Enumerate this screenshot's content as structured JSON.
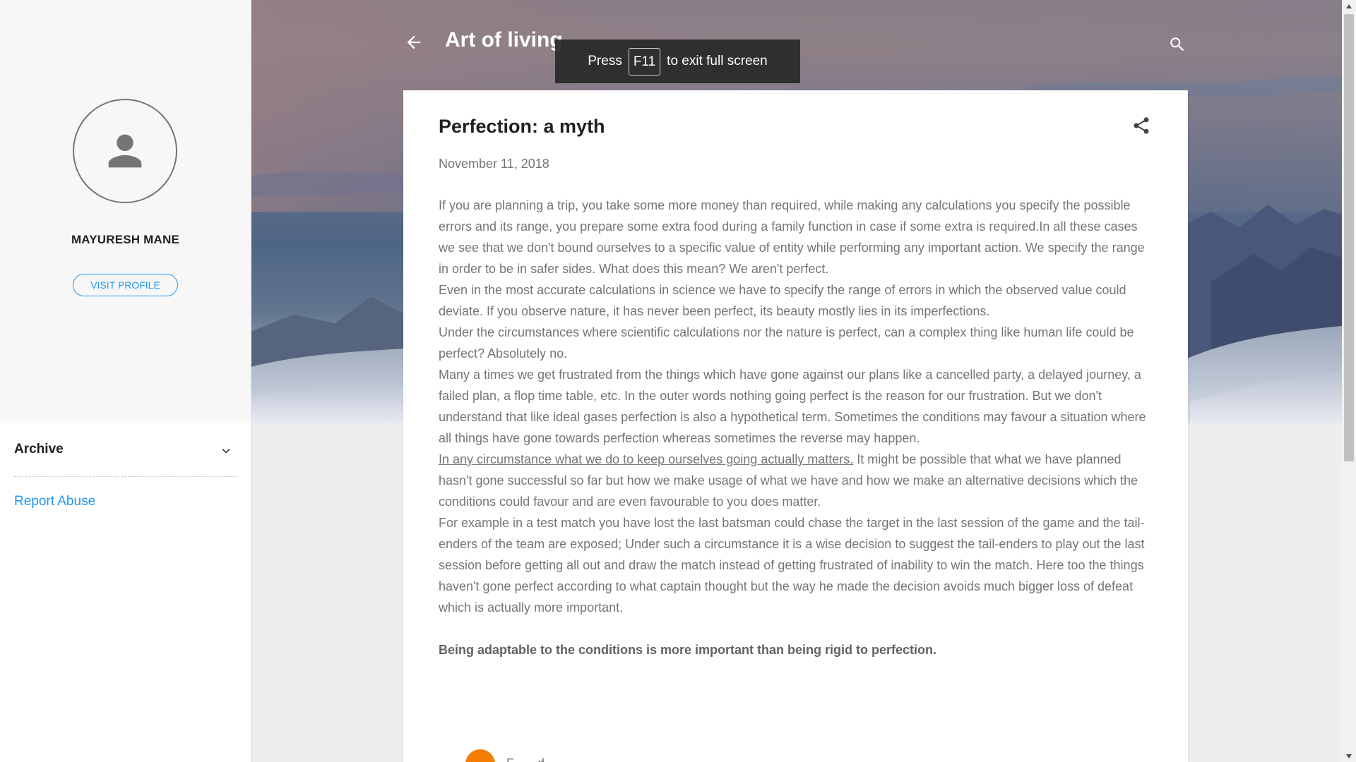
{
  "sidebar": {
    "profile_name": "MAYURESH MANE",
    "visit_profile_label": "VISIT PROFILE",
    "archive_label": "Archive",
    "report_abuse_label": "Report Abuse"
  },
  "header": {
    "blog_title": "Art of living"
  },
  "fullscreen_toast": {
    "prefix": "Press",
    "key": "F11",
    "suffix": "to exit full screen"
  },
  "post": {
    "title": "Perfection: a myth",
    "date": "November 11, 2018",
    "paragraphs": {
      "p1": " If you are planning a trip, you take some more money than required, while making any calculations you specify the possible errors and its range, you prepare some extra food during a family function in case if some extra is required.In all these cases we see that we don't bound ourselves to a specific value of entity while performing any important action. We specify the range in order to be in safer sides. What does this mean? We aren't perfect.",
      "p2": "Even in the most accurate calculations in science we have to specify the range of errors in which the observed value could deviate. If you observe nature, it has never been perfect, its beauty mostly lies in its imperfections.",
      "p3": "Under the circumstances where scientific calculations nor the nature is perfect, can a complex thing like human life could be perfect? Absolutely no.",
      "p4": "Many a times we get frustrated from the things which have gone against our plans like a cancelled party, a delayed journey, a failed plan, a flop time table, etc. In the outer words nothing going perfect is the reason for our frustration. But we don't understand that like ideal gases perfection is also a hypothetical term. Sometimes the conditions may favour a situation where all things have gone towards perfection whereas sometimes the reverse may happen.",
      "p5_link": "In any circumstance what we do to keep ourselves going actually matters.",
      "p5_rest": " It might be possible that what we have planned hasn't gone successful so far but how we make usage of what we have and how we make an alternative decisions which the conditions could favour and are even favourable to you does matter.",
      "p6": "For example in a test match you have lost the last batsman could chase the target in the last session of the game and the tail-enders of the team are exposed; Under such a circumstance it is a wise decision to suggest the tail-enders to play out the last session before getting all out and draw the match instead of getting frustrated of inability to win the match. Here too the things haven't gone perfect according to what captain thought but the way he made the decision avoids much bigger loss of defeat which is actually more important.",
      "conclusion": "Being adaptable to the conditions is more important than being rigid to perfection."
    },
    "author_partial": "F... ...d"
  },
  "icons": {
    "back": "arrow-left-icon",
    "search": "search-icon",
    "share": "share-icon",
    "avatar": "person-icon",
    "chevron": "chevron-down-icon"
  },
  "colors": {
    "accent": "#2196f3",
    "text_primary": "#212121",
    "text_secondary": "#757575",
    "blogger_orange": "#f57d00"
  }
}
